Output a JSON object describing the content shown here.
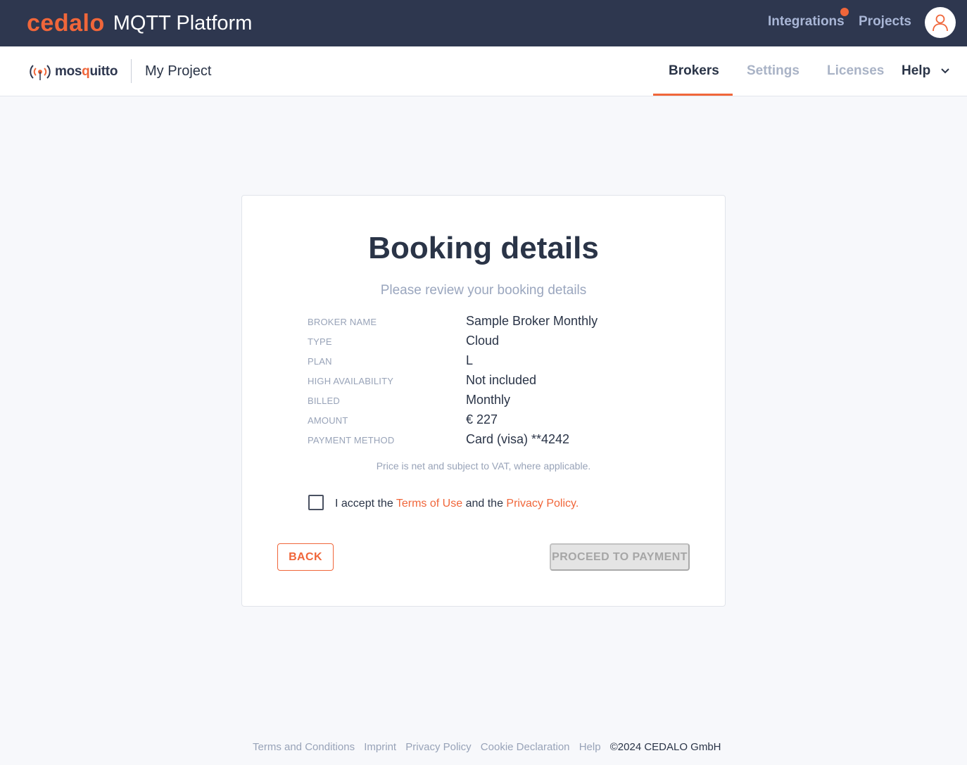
{
  "header": {
    "brand_name": "cedalo",
    "product_name": "MQTT Platform",
    "links": {
      "integrations": "Integrations",
      "projects": "Projects"
    },
    "accent_color": "#f0663a",
    "bg_color": "#2e374f",
    "avatar_icon": "user-icon"
  },
  "subheader": {
    "logo_text_a": "mos",
    "logo_text_b": "q",
    "logo_text_c": "uitto",
    "project_name": "My Project",
    "tabs": {
      "brokers": "Brokers",
      "settings": "Settings",
      "licenses": "Licenses",
      "help": "Help"
    },
    "active_tab": "Brokers"
  },
  "booking": {
    "title": "Booking details",
    "subtitle": "Please review your booking details",
    "rows": [
      {
        "label": "BROKER NAME",
        "value": "Sample Broker Monthly"
      },
      {
        "label": "TYPE",
        "value": "Cloud"
      },
      {
        "label": "PLAN",
        "value": "L"
      },
      {
        "label": "HIGH AVAILABILITY",
        "value": "Not included"
      },
      {
        "label": "BILLED",
        "value": "Monthly"
      },
      {
        "label": "AMOUNT",
        "value": "€ 227"
      },
      {
        "label": "PAYMENT METHOD",
        "value": "Card (visa) **4242"
      }
    ],
    "price_note": "Price is net and subject to VAT, where applicable.",
    "accept": {
      "prefix": "I accept the",
      "terms": "Terms of Use",
      "middle": "and the",
      "privacy": "Privacy Policy.",
      "checked": false
    },
    "back_label": "BACK",
    "proceed_label": "PROCEED TO PAYMENT",
    "proceed_enabled": false
  },
  "footer": {
    "links": [
      "Terms and Conditions",
      "Imprint",
      "Privacy Policy",
      "Cookie Declaration",
      "Help"
    ],
    "copyright": "©2024 CEDALO GmbH"
  }
}
